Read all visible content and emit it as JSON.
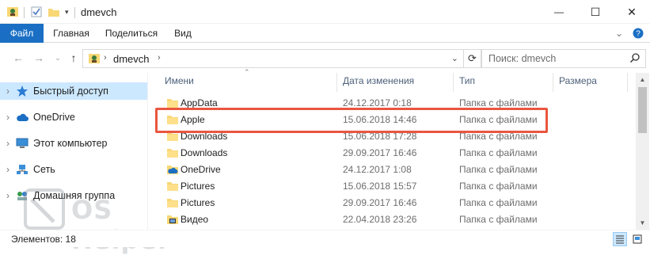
{
  "window": {
    "title": "dmevch",
    "minimize": "—",
    "maximize": "☐",
    "close": "✕"
  },
  "ribbon": {
    "tabs": [
      "Файл",
      "Главная",
      "Поделиться",
      "Вид"
    ]
  },
  "address": {
    "path": "dmevch",
    "search_placeholder": "Поиск: dmevch"
  },
  "sidebar": {
    "items": [
      {
        "label": "Быстрый доступ",
        "icon": "star-icon",
        "selected": true
      },
      {
        "label": "OneDrive",
        "icon": "cloud-icon",
        "selected": false
      },
      {
        "label": "Этот компьютер",
        "icon": "computer-icon",
        "selected": false
      },
      {
        "label": "Сеть",
        "icon": "network-icon",
        "selected": false
      },
      {
        "label": "Домашняя группа",
        "icon": "homegroup-icon",
        "selected": false
      }
    ]
  },
  "columns": {
    "name": "Имени",
    "date": "Дата изменения",
    "type": "Тип",
    "size": "Размера"
  },
  "files": [
    {
      "name": "AppData",
      "date": "24.12.2017 0:18",
      "type": "Папка с файлами",
      "icon": "folder-icon"
    },
    {
      "name": "Apple",
      "date": "15.06.2018 14:46",
      "type": "Папка с файлами",
      "icon": "folder-icon"
    },
    {
      "name": "Downloads",
      "date": "15.06.2018 17:28",
      "type": "Папка с файлами",
      "icon": "folder-icon"
    },
    {
      "name": "Downloads",
      "date": "29.09.2017 16:46",
      "type": "Папка с файлами",
      "icon": "folder-icon"
    },
    {
      "name": "OneDrive",
      "date": "24.12.2017 1:08",
      "type": "Папка с файлами",
      "icon": "onedrive-folder-icon"
    },
    {
      "name": "Pictures",
      "date": "15.06.2018 15:57",
      "type": "Папка с файлами",
      "icon": "folder-icon"
    },
    {
      "name": "Pictures",
      "date": "29.09.2017 16:46",
      "type": "Папка с файлами",
      "icon": "folder-icon"
    },
    {
      "name": "Видео",
      "date": "22.04.2018 23:26",
      "type": "Папка с файлами",
      "icon": "video-folder-icon"
    }
  ],
  "status": {
    "count": "Элементов: 18"
  },
  "watermark": {
    "text": "OS Helper"
  },
  "colors": {
    "file_tab": "#1a6fc4",
    "selection": "#cce8ff",
    "highlight": "#e9563f",
    "folder": "#f8d775"
  }
}
